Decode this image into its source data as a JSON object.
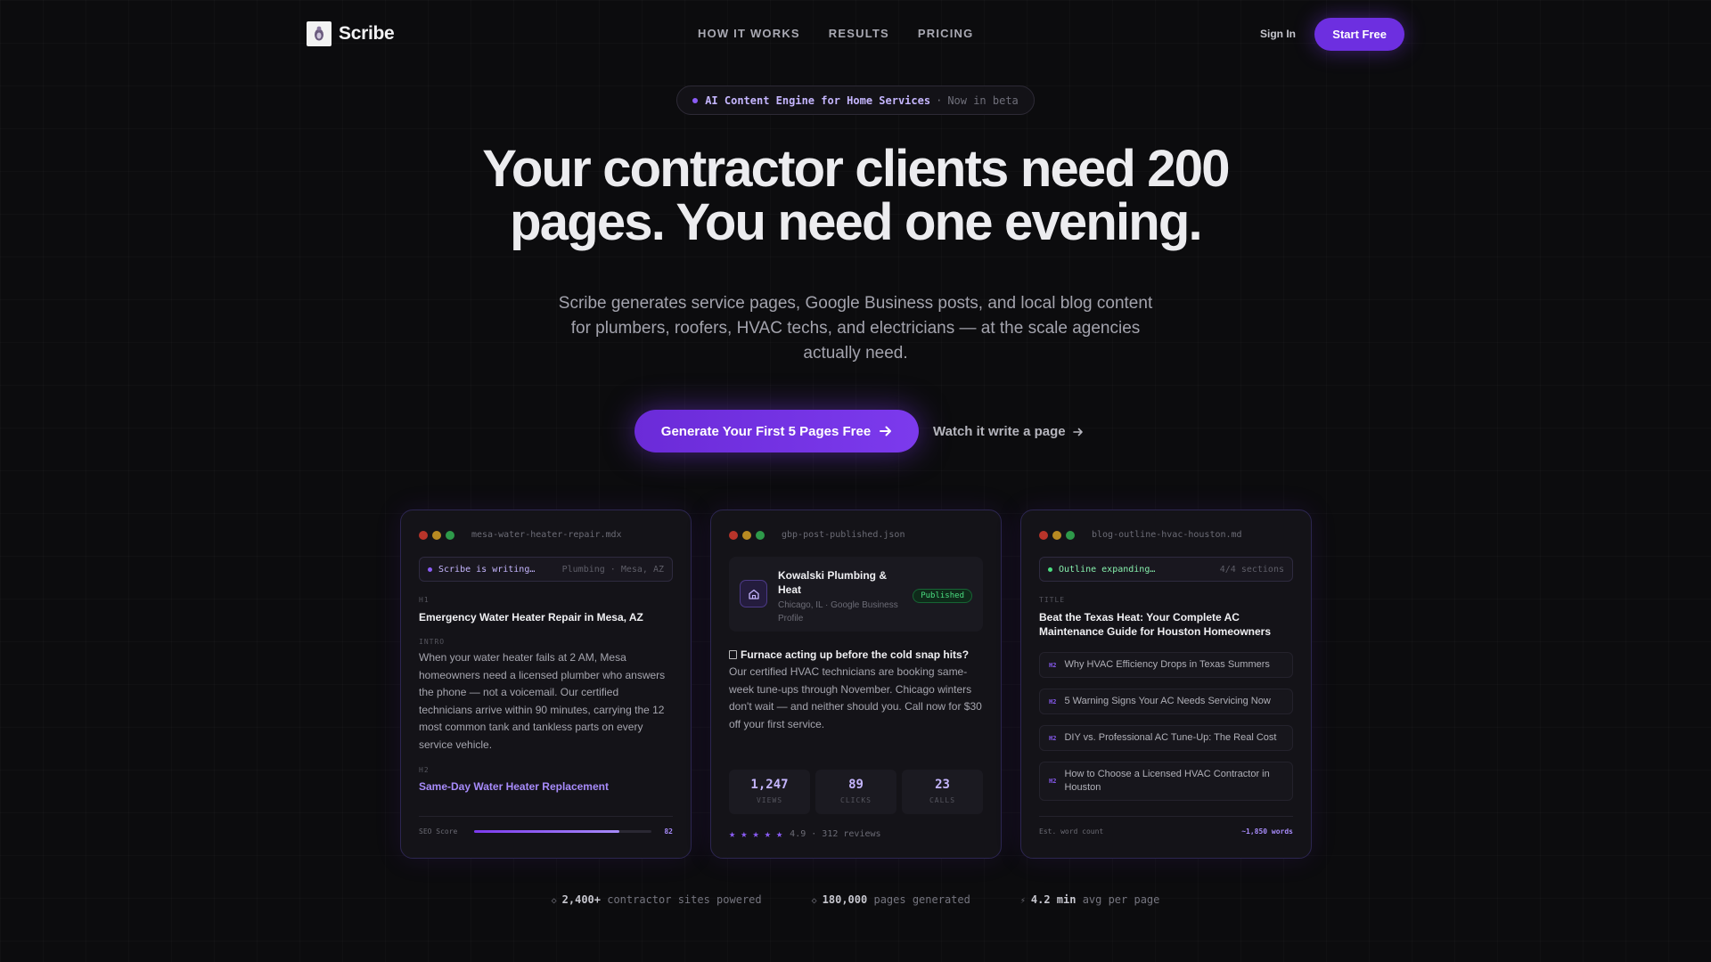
{
  "nav": {
    "brand": "Scribe",
    "links": [
      "HOW IT WORKS",
      "RESULTS",
      "PRICING"
    ],
    "sign_in": "Sign In",
    "start": "Start Free"
  },
  "badge": {
    "label": "AI Content Engine for Home Services",
    "separator": "·",
    "status": "Now in beta"
  },
  "hero": {
    "title_line1": "Your contractor clients need 200",
    "title_line2": "pages. You need one evening.",
    "subtitle": "Scribe generates service pages, Google Business posts, and local blog content for plumbers, roofers, HVAC techs, and electricians — at the scale agencies actually need.",
    "cta_primary": "Generate Your First 5 Pages Free",
    "cta_secondary": "Watch it write a page"
  },
  "card1": {
    "filename": "mesa-water-heater-repair.mdx",
    "status": "Scribe is writing…",
    "status_meta": "Plumbing · Mesa, AZ",
    "h1_tag": "H1",
    "h1": "Emergency Water Heater Repair in Mesa, AZ",
    "intro_tag": "INTRO",
    "intro": "When your water heater fails at 2 AM, Mesa homeowners need a licensed plumber who answers the phone — not a voicemail. Our certified technicians arrive within 90 minutes, carrying the 12 most common tank and tankless parts on every service vehicle.",
    "h2_tag": "H2",
    "h2": "Same-Day Water Heater Replacement",
    "seo_label": "SEO Score",
    "seo_value": "82",
    "seo_fraction": 0.82
  },
  "card2": {
    "filename": "gbp-post-published.json",
    "business": "Kowalski Plumbing & Heat",
    "location": "Chicago, IL · Google Business Profile",
    "published": "Published",
    "post_title": "Furnace acting up before the cold snap hits?",
    "post_body": "Our certified HVAC technicians are booking same-week tune-ups through November. Chicago winters don't wait — and neither should you. Call now for $30 off your first service.",
    "stats": [
      {
        "value": "1,247",
        "label": "VIEWS"
      },
      {
        "value": "89",
        "label": "CLICKS"
      },
      {
        "value": "23",
        "label": "CALLS"
      }
    ],
    "rating": "4.9 · 312 reviews",
    "stars": 5
  },
  "card3": {
    "filename": "blog-outline-hvac-houston.md",
    "status": "Outline expanding…",
    "status_meta": "4/4 sections",
    "title_tag": "TITLE",
    "title": "Beat the Texas Heat: Your Complete AC Maintenance Guide for Houston Homeowners",
    "sections": [
      {
        "tag": "H2",
        "text": "Why HVAC Efficiency Drops in Texas Summers"
      },
      {
        "tag": "H2",
        "text": "5 Warning Signs Your AC Needs Servicing Now"
      },
      {
        "tag": "H2",
        "text": "DIY vs. Professional AC Tune-Up: The Real Cost"
      },
      {
        "tag": "H2",
        "text": "How to Choose a Licensed HVAC Contractor in Houston"
      }
    ],
    "wc_label": "Est. word count",
    "wc_value": "~1,850 words"
  },
  "bottom": [
    {
      "icon": "◇",
      "value": "2,400+",
      "label": "contractor sites powered"
    },
    {
      "icon": "◇",
      "value": "180,000",
      "label": "pages generated"
    },
    {
      "icon": "⚡",
      "value": "4.2 min",
      "label": "avg per page"
    }
  ],
  "colors": {
    "accent": "#7c3aed",
    "accent_light": "#a78bfa",
    "background": "#0c0c0e",
    "success": "#4ade80"
  }
}
